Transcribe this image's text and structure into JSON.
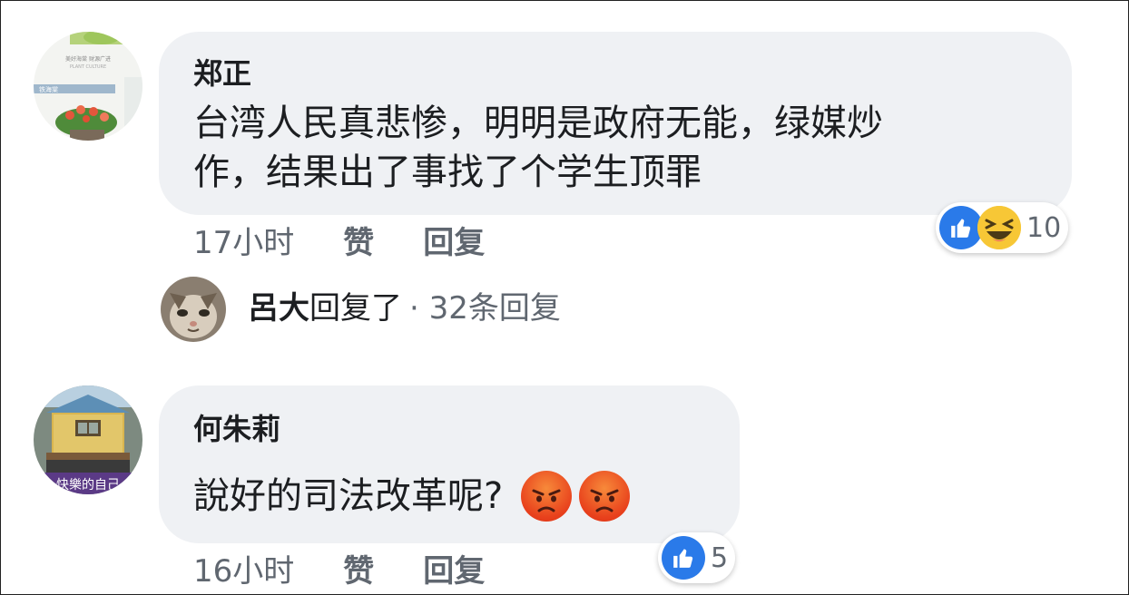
{
  "comments": [
    {
      "author": "郑正",
      "text_line1": "台湾人民真悲惨，明明是政府无能，绿媒炒",
      "text_line2": "作，结果出了事找了个学生顶罪",
      "time": "17小时",
      "like_label": "赞",
      "reply_label": "回复",
      "reaction_count": "10",
      "reactions": [
        "like-icon",
        "haha-icon"
      ],
      "avatar_text_1": "美好海棠  财源广进",
      "avatar_text_2": "PLANT CULTURE",
      "avatar_text_3": "铁海棠"
    },
    {
      "author": "何朱莉",
      "text": "說好的司法改革呢?",
      "time": "16小时",
      "like_label": "赞",
      "reply_label": "回复",
      "reaction_count": "5",
      "reactions": [
        "like-icon"
      ],
      "inline_emoji": [
        "angry-face-icon",
        "angry-face-icon"
      ],
      "avatar_text": "快樂的自己"
    }
  ],
  "reply_thread": {
    "author": "呂大",
    "action": "回复了",
    "count": "· 32条回复"
  },
  "colors": {
    "bubble": "#eff1f4",
    "like_blue": "#2a7ae9",
    "haha_yellow": "#f7c736",
    "meta_gray": "#606770"
  }
}
